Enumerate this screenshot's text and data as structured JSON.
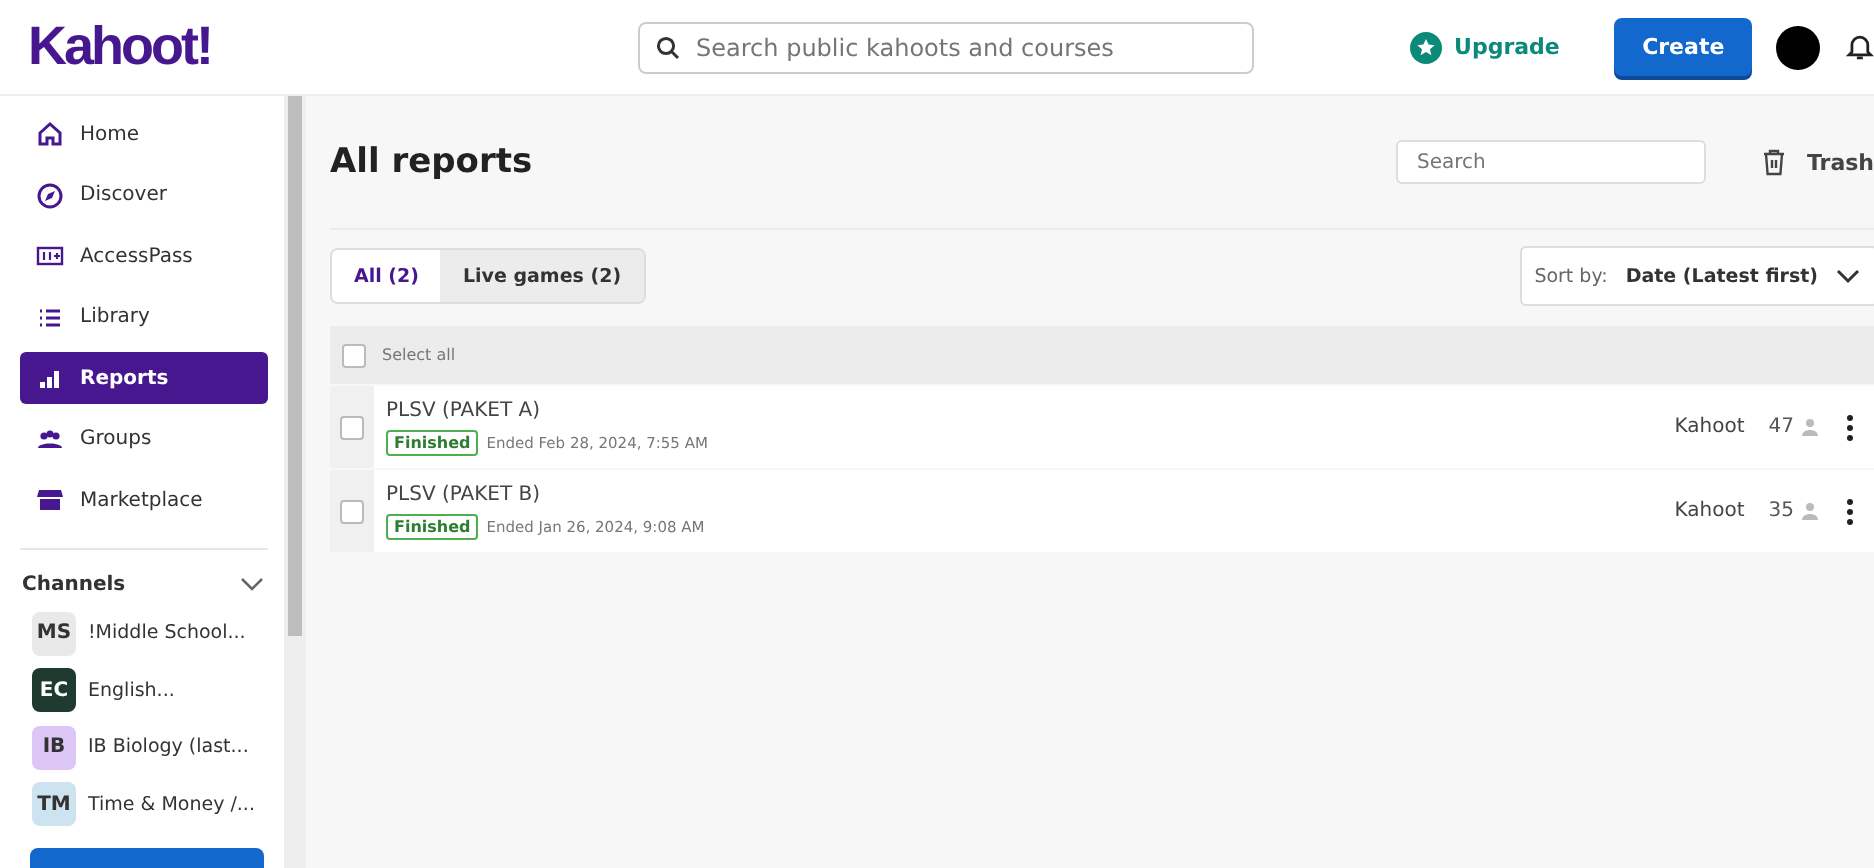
{
  "header": {
    "logo": "Kahoot!",
    "search": {
      "placeholder": "Search public kahoots and courses"
    },
    "upgrade": "Upgrade",
    "create": "Create"
  },
  "sidebar": {
    "items": [
      {
        "label": "Home",
        "kind": "home",
        "selected": false
      },
      {
        "label": "Discover",
        "kind": "discover",
        "selected": false
      },
      {
        "label": "AccessPass",
        "kind": "accesspass",
        "selected": false
      },
      {
        "label": "Library",
        "kind": "library",
        "selected": false
      },
      {
        "label": "Reports",
        "kind": "reports",
        "selected": true
      },
      {
        "label": "Groups",
        "kind": "groups",
        "selected": false
      },
      {
        "label": "Marketplace",
        "kind": "marketplace",
        "selected": false
      }
    ],
    "channels_title": "Channels",
    "channels": [
      {
        "initials": "MS",
        "name": "!Middle School...",
        "color": "#e9e9e9"
      },
      {
        "initials": "EC",
        "name": "English...",
        "color": "#1f3a2e"
      },
      {
        "initials": "IB",
        "name": "IB Biology (last...",
        "color": "#dcc6f5"
      },
      {
        "initials": "TM",
        "name": "Time & Money /...",
        "color": "#cde3f0"
      }
    ]
  },
  "main": {
    "title": "All reports",
    "search": {
      "placeholder": "Search"
    },
    "trash": "Trash",
    "tabs": [
      {
        "label": "All (2)",
        "selected": true
      },
      {
        "label": "Live games (2)",
        "selected": false
      }
    ],
    "sort": {
      "label": "Sort by:",
      "value": "Date (Latest first)"
    },
    "select_all": {
      "label": "Select all",
      "checked": false
    },
    "rows": [
      {
        "name": "PLSV (PAKET A)",
        "status": "Finished",
        "ended": "Ended Feb 28, 2024, 7:55 AM",
        "type": "Kahoot",
        "players": "47",
        "checked": false
      },
      {
        "name": "PLSV (PAKET B)",
        "status": "Finished",
        "ended": "Ended Jan 26, 2024, 9:08 AM",
        "type": "Kahoot",
        "players": "35",
        "checked": false
      }
    ]
  }
}
